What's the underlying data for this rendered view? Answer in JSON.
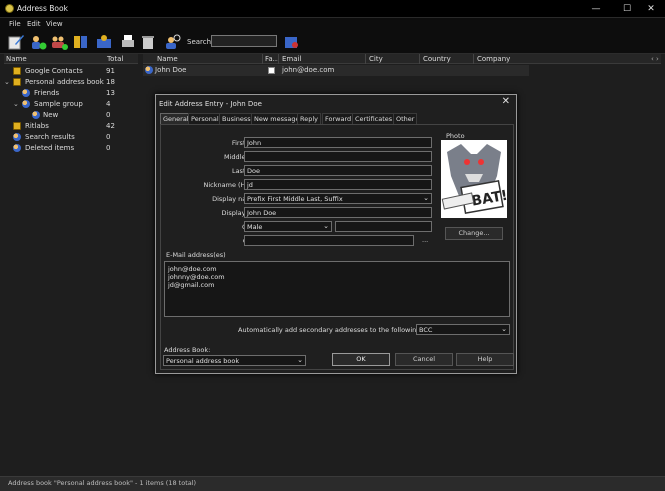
{
  "window": {
    "title": "Address Book",
    "minimize": "—",
    "maximize": "☐",
    "close": "✕"
  },
  "menu": [
    "File",
    "Edit",
    "View"
  ],
  "toolbar": {
    "search_label": "Search:",
    "search_value": ""
  },
  "tree": {
    "headers": {
      "name": "Name",
      "total": "Total"
    },
    "rows": [
      {
        "label": "Google Contacts",
        "total": "91"
      },
      {
        "label": "Personal address book",
        "total": "18"
      },
      {
        "label": "Friends",
        "total": "13"
      },
      {
        "label": "Sample group",
        "total": "4"
      },
      {
        "label": "New",
        "total": "0"
      },
      {
        "label": "Ritlabs",
        "total": "42"
      },
      {
        "label": "Search results",
        "total": "0"
      },
      {
        "label": "Deleted items",
        "total": "0"
      }
    ]
  },
  "grid": {
    "headers": [
      "Name",
      "Fa...",
      "Email",
      "City",
      "Country",
      "Company"
    ],
    "rows": [
      {
        "name": "John Doe",
        "email": "john@doe.com"
      }
    ]
  },
  "status": "Address book \"Personal address book\" - 1 items (18 total)",
  "dialog": {
    "title": "Edit Address Entry - John Doe",
    "tabs": [
      "General",
      "Personal",
      "Business",
      "New message",
      "Reply",
      "Forward",
      "Certificates",
      "Other"
    ],
    "labels": {
      "first_name": "First name",
      "middle_name": "Middle name",
      "last_name": "Last name",
      "nickname": "Nickname (Handle)",
      "display_as": "Display name as",
      "display_name": "Display name",
      "gender": "Gender",
      "groups": "Groups",
      "photo": "Photo",
      "emails": "E-Mail address(es)",
      "auto_add": "Automatically add secondary addresses to the following field:",
      "address_book": "Address Book:"
    },
    "values": {
      "first_name": "John",
      "middle_name": "",
      "last_name": "Doe",
      "nickname": "jd",
      "display_as": "Prefix First Middle Last, Suffix",
      "display_name": "John Doe",
      "gender": "Male",
      "groups": "",
      "emails": [
        "john@doe.com",
        "johnny@doe.com",
        "jd@gmail.com"
      ],
      "auto_add": "BCC",
      "address_book": "Personal address book"
    },
    "groups_more": "...",
    "buttons": {
      "change": "Change...",
      "ok": "OK",
      "cancel": "Cancel",
      "help": "Help"
    }
  }
}
